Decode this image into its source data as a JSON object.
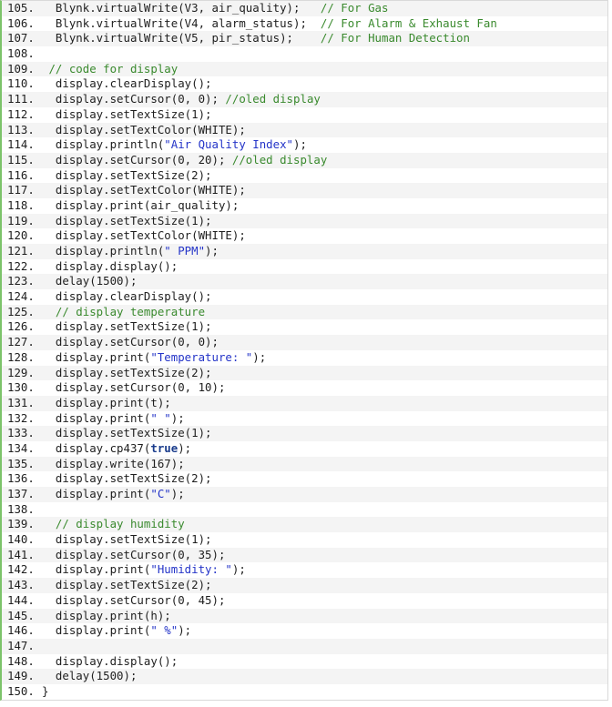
{
  "colors": {
    "comment": "#3a8a2e",
    "string": "#2434c8",
    "keyword": "#1a3c8c",
    "gutter_bar": "#7cc36a"
  },
  "lines": [
    {
      "n": "105.",
      "seg": [
        [
          "p",
          "  Blynk.virtualWrite(V3, air_quality);   "
        ],
        [
          "c",
          "// For Gas"
        ]
      ]
    },
    {
      "n": "106.",
      "seg": [
        [
          "p",
          "  Blynk.virtualWrite(V4, alarm_status);  "
        ],
        [
          "c",
          "// For Alarm & Exhaust Fan"
        ]
      ]
    },
    {
      "n": "107.",
      "seg": [
        [
          "p",
          "  Blynk.virtualWrite(V5, pir_status);    "
        ],
        [
          "c",
          "// For Human Detection"
        ]
      ]
    },
    {
      "n": "108.",
      "seg": []
    },
    {
      "n": "109.",
      "seg": [
        [
          "c",
          " // code for display"
        ]
      ]
    },
    {
      "n": "110.",
      "seg": [
        [
          "p",
          "  display.clearDisplay();"
        ]
      ]
    },
    {
      "n": "111.",
      "seg": [
        [
          "p",
          "  display.setCursor(0, 0); "
        ],
        [
          "c",
          "//oled display"
        ]
      ]
    },
    {
      "n": "112.",
      "seg": [
        [
          "p",
          "  display.setTextSize(1);"
        ]
      ]
    },
    {
      "n": "113.",
      "seg": [
        [
          "p",
          "  display.setTextColor(WHITE);"
        ]
      ]
    },
    {
      "n": "114.",
      "seg": [
        [
          "p",
          "  display.println("
        ],
        [
          "s",
          "\"Air Quality Index\""
        ],
        [
          "p",
          ");"
        ]
      ]
    },
    {
      "n": "115.",
      "seg": [
        [
          "p",
          "  display.setCursor(0, 20); "
        ],
        [
          "c",
          "//oled display"
        ]
      ]
    },
    {
      "n": "116.",
      "seg": [
        [
          "p",
          "  display.setTextSize(2);"
        ]
      ]
    },
    {
      "n": "117.",
      "seg": [
        [
          "p",
          "  display.setTextColor(WHITE);"
        ]
      ]
    },
    {
      "n": "118.",
      "seg": [
        [
          "p",
          "  display.print(air_quality);"
        ]
      ]
    },
    {
      "n": "119.",
      "seg": [
        [
          "p",
          "  display.setTextSize(1);"
        ]
      ]
    },
    {
      "n": "120.",
      "seg": [
        [
          "p",
          "  display.setTextColor(WHITE);"
        ]
      ]
    },
    {
      "n": "121.",
      "seg": [
        [
          "p",
          "  display.println("
        ],
        [
          "s",
          "\" PPM\""
        ],
        [
          "p",
          ");"
        ]
      ]
    },
    {
      "n": "122.",
      "seg": [
        [
          "p",
          "  display.display();"
        ]
      ]
    },
    {
      "n": "123.",
      "seg": [
        [
          "p",
          "  delay(1500);"
        ]
      ]
    },
    {
      "n": "124.",
      "seg": [
        [
          "p",
          "  display.clearDisplay();"
        ]
      ]
    },
    {
      "n": "125.",
      "seg": [
        [
          "c",
          "  // display temperature"
        ]
      ]
    },
    {
      "n": "126.",
      "seg": [
        [
          "p",
          "  display.setTextSize(1);"
        ]
      ]
    },
    {
      "n": "127.",
      "seg": [
        [
          "p",
          "  display.setCursor(0, 0);"
        ]
      ]
    },
    {
      "n": "128.",
      "seg": [
        [
          "p",
          "  display.print("
        ],
        [
          "s",
          "\"Temperature: \""
        ],
        [
          "p",
          ");"
        ]
      ]
    },
    {
      "n": "129.",
      "seg": [
        [
          "p",
          "  display.setTextSize(2);"
        ]
      ]
    },
    {
      "n": "130.",
      "seg": [
        [
          "p",
          "  display.setCursor(0, 10);"
        ]
      ]
    },
    {
      "n": "131.",
      "seg": [
        [
          "p",
          "  display.print(t);"
        ]
      ]
    },
    {
      "n": "132.",
      "seg": [
        [
          "p",
          "  display.print("
        ],
        [
          "s",
          "\" \""
        ],
        [
          "p",
          ");"
        ]
      ]
    },
    {
      "n": "133.",
      "seg": [
        [
          "p",
          "  display.setTextSize(1);"
        ]
      ]
    },
    {
      "n": "134.",
      "seg": [
        [
          "p",
          "  display.cp437("
        ],
        [
          "k",
          "true"
        ],
        [
          "p",
          ");"
        ]
      ]
    },
    {
      "n": "135.",
      "seg": [
        [
          "p",
          "  display.write(167);"
        ]
      ]
    },
    {
      "n": "136.",
      "seg": [
        [
          "p",
          "  display.setTextSize(2);"
        ]
      ]
    },
    {
      "n": "137.",
      "seg": [
        [
          "p",
          "  display.print("
        ],
        [
          "s",
          "\"C\""
        ],
        [
          "p",
          ");"
        ]
      ]
    },
    {
      "n": "138.",
      "seg": []
    },
    {
      "n": "139.",
      "seg": [
        [
          "c",
          "  // display humidity"
        ]
      ]
    },
    {
      "n": "140.",
      "seg": [
        [
          "p",
          "  display.setTextSize(1);"
        ]
      ]
    },
    {
      "n": "141.",
      "seg": [
        [
          "p",
          "  display.setCursor(0, 35);"
        ]
      ]
    },
    {
      "n": "142.",
      "seg": [
        [
          "p",
          "  display.print("
        ],
        [
          "s",
          "\"Humidity: \""
        ],
        [
          "p",
          ");"
        ]
      ]
    },
    {
      "n": "143.",
      "seg": [
        [
          "p",
          "  display.setTextSize(2);"
        ]
      ]
    },
    {
      "n": "144.",
      "seg": [
        [
          "p",
          "  display.setCursor(0, 45);"
        ]
      ]
    },
    {
      "n": "145.",
      "seg": [
        [
          "p",
          "  display.print(h);"
        ]
      ]
    },
    {
      "n": "146.",
      "seg": [
        [
          "p",
          "  display.print("
        ],
        [
          "s",
          "\" %\""
        ],
        [
          "p",
          ");"
        ]
      ]
    },
    {
      "n": "147.",
      "seg": []
    },
    {
      "n": "148.",
      "seg": [
        [
          "p",
          "  display.display();"
        ]
      ]
    },
    {
      "n": "149.",
      "seg": [
        [
          "p",
          "  delay(1500);"
        ]
      ]
    },
    {
      "n": "150.",
      "seg": [
        [
          "p",
          "}"
        ]
      ]
    }
  ]
}
